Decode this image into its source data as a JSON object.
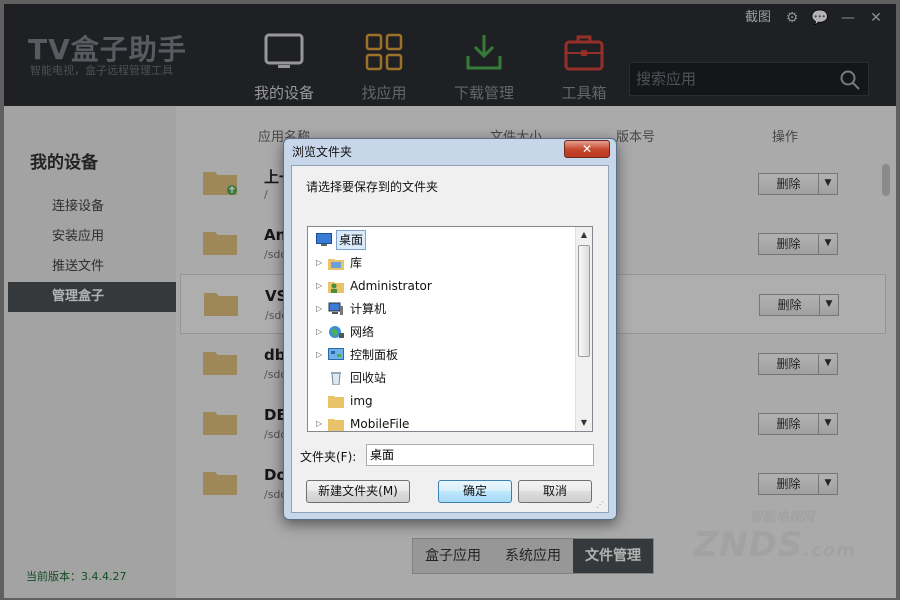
{
  "app": {
    "logo": "TV盒子助手",
    "logo_sub": "智能电视，盒子远程管理工具",
    "screenshot_label": "截图",
    "version": "当前版本：3.4.4.27"
  },
  "nav": [
    {
      "label": "我的设备",
      "icon": "tv-icon"
    },
    {
      "label": "找应用",
      "icon": "grid-icon"
    },
    {
      "label": "下载管理",
      "icon": "download-icon"
    },
    {
      "label": "工具箱",
      "icon": "toolbox-icon"
    }
  ],
  "search": {
    "placeholder": "搜索应用"
  },
  "sidebar": {
    "title": "我的设备",
    "items": [
      {
        "label": "连接设备"
      },
      {
        "label": "安装应用"
      },
      {
        "label": "推送文件"
      },
      {
        "label": "管理盒子"
      }
    ]
  },
  "table": {
    "headers": [
      "应用名称",
      "文件大小",
      "版本号",
      "操作"
    ],
    "rows": [
      {
        "name": "上一",
        "path": "/"
      },
      {
        "name": "And",
        "path": "/sdc"
      },
      {
        "name": "VST",
        "path": "/sdc"
      },
      {
        "name": "dbl",
        "path": "/sdc"
      },
      {
        "name": "DBI",
        "path": "/sdc"
      },
      {
        "name": "Dov",
        "path": "/sdc"
      }
    ],
    "action_label": "删除"
  },
  "bottom_tabs": [
    "盒子应用",
    "系统应用",
    "文件管理"
  ],
  "watermark": {
    "top": "智能电视网",
    "main": "ZNDS",
    "suffix": ".com"
  },
  "dialog": {
    "title": "浏览文件夹",
    "close_label": "✕",
    "prompt": "请选择要保存到的文件夹",
    "tree": [
      {
        "label": "桌面",
        "icon": "desktop-icon",
        "expandable": false,
        "selected": true
      },
      {
        "label": "库",
        "icon": "library-icon",
        "expandable": true
      },
      {
        "label": "Administrator",
        "icon": "user-folder-icon",
        "expandable": true
      },
      {
        "label": "计算机",
        "icon": "computer-icon",
        "expandable": true
      },
      {
        "label": "网络",
        "icon": "network-icon",
        "expandable": true
      },
      {
        "label": "控制面板",
        "icon": "control-panel-icon",
        "expandable": true
      },
      {
        "label": "回收站",
        "icon": "recycle-bin-icon",
        "expandable": false
      },
      {
        "label": "img",
        "icon": "folder-icon",
        "expandable": false
      },
      {
        "label": "MobileFile",
        "icon": "folder-icon",
        "expandable": true
      }
    ],
    "folder_label": "文件夹(F):",
    "folder_value": "桌面",
    "new_folder_button": "新建文件夹(M)",
    "ok_button": "确定",
    "cancel_button": "取消"
  },
  "colors": {
    "header_bg": "#2b2f33",
    "active_bg": "#4e5256",
    "folder": "#e3c27e",
    "dialog_frame": "#c7d6e8"
  }
}
